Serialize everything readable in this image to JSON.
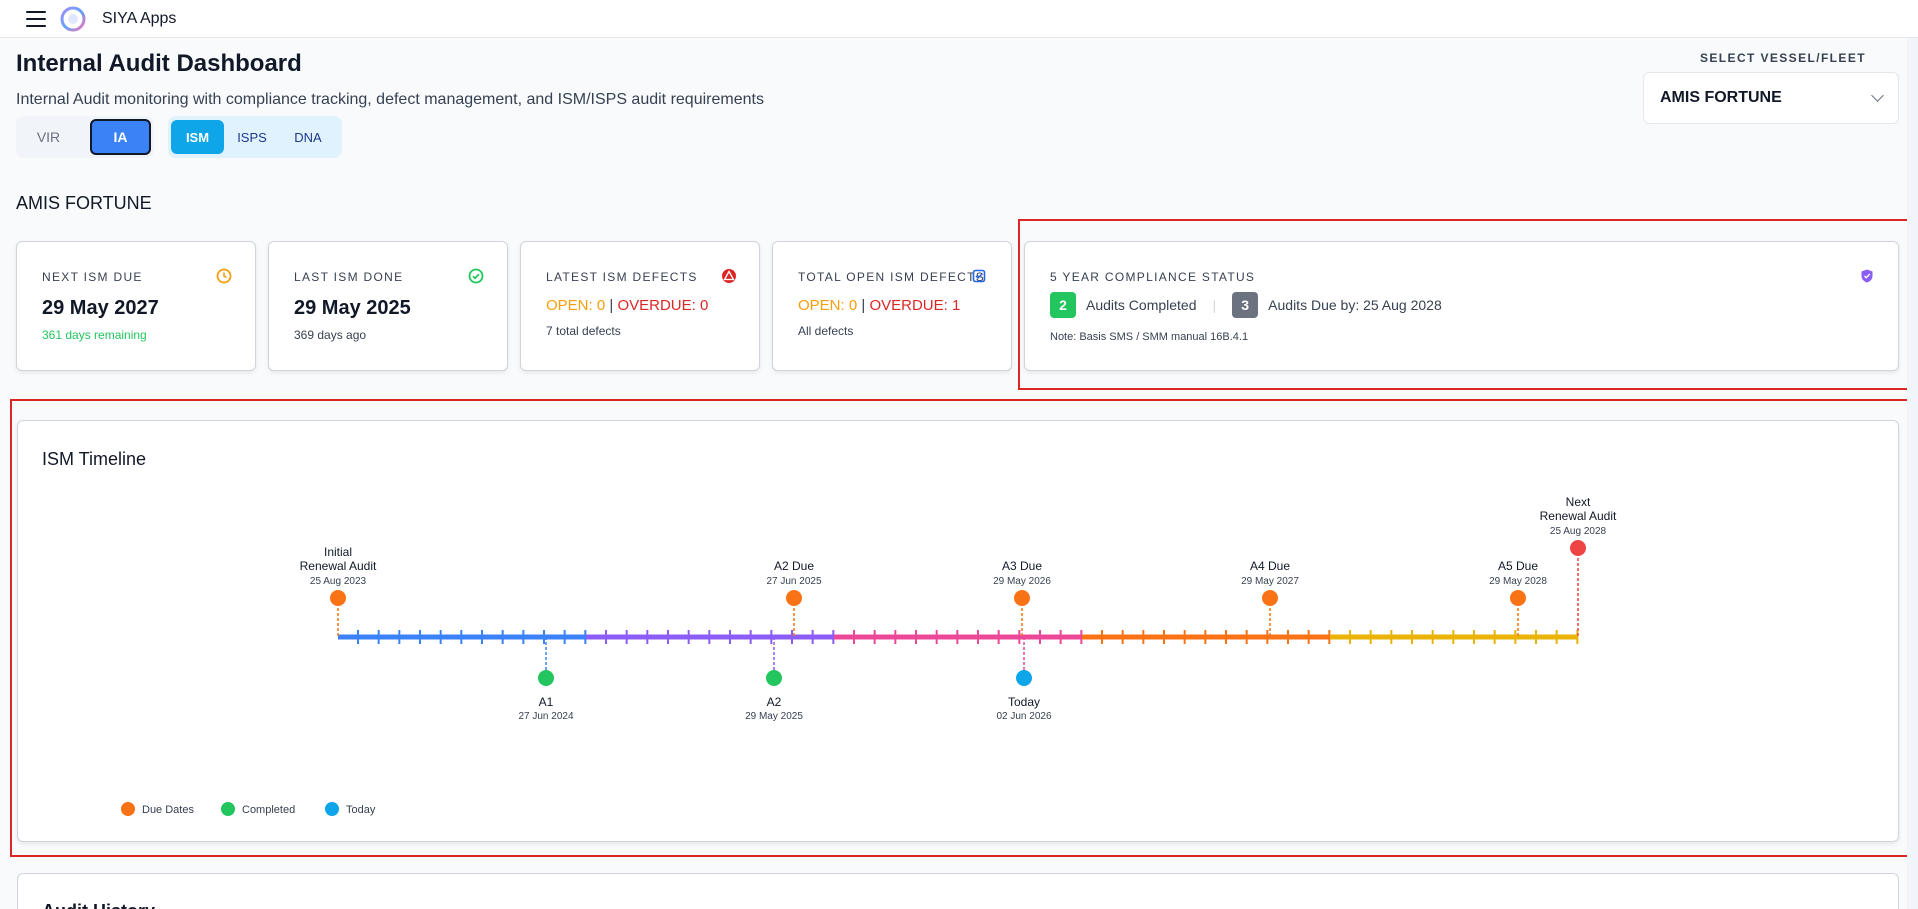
{
  "app": {
    "title": "SIYA Apps"
  },
  "page": {
    "title": "Internal Audit Dashboard",
    "subtitle": "Internal Audit monitoring with compliance tracking, defect management, and ISM/ISPS audit requirements"
  },
  "toggles": {
    "group1": [
      {
        "label": "VIR",
        "active": false
      },
      {
        "label": "IA",
        "active": true
      }
    ],
    "group2": [
      {
        "label": "ISM",
        "active": true
      },
      {
        "label": "ISPS",
        "active": false
      },
      {
        "label": "DNA",
        "active": false
      }
    ]
  },
  "vessel": {
    "select_label": "SELECT VESSEL/FLEET",
    "selected": "AMIS FORTUNE",
    "heading": "AMIS FORTUNE"
  },
  "cards": {
    "next_ism": {
      "label": "NEXT ISM DUE",
      "value": "29 May 2027",
      "note": "361 days remaining"
    },
    "last_ism": {
      "label": "LAST ISM DONE",
      "value": "29 May 2025",
      "note": "369 days ago"
    },
    "latest_defects": {
      "label": "LATEST ISM DEFECTS",
      "open": "OPEN: 0",
      "sep": "|",
      "overdue": "OVERDUE: 0",
      "note": "7 total defects"
    },
    "total_open": {
      "label": "TOTAL OPEN ISM DEFECTS",
      "open": "OPEN: 0",
      "sep": "|",
      "overdue": "OVERDUE: 1",
      "note": "All defects"
    },
    "compliance": {
      "label": "5 YEAR COMPLIANCE STATUS",
      "completed_count": "2",
      "completed_text": "Audits Completed",
      "divider": "|",
      "due_count": "3",
      "due_text": "Audits Due by: 25 Aug 2028",
      "note": "Note: Basis SMS / SMM manual 16B.4.1"
    }
  },
  "timeline": {
    "title": "ISM Timeline",
    "colors": {
      "segments": [
        "#3b82f6",
        "#8b5cf6",
        "#ec4899",
        "#f97316",
        "#eab308"
      ],
      "due": "#f97316",
      "completed": "#22c55e",
      "today": "#0ea5e9",
      "renewal_next": "#ef4444"
    },
    "above": [
      {
        "name": "initial-renewal",
        "title1": "Initial",
        "title2": "Renewal Audit",
        "date": "25 Aug 2023",
        "kind": "due"
      },
      {
        "name": "a2-due",
        "title1": "A2 Due",
        "title2": "",
        "date": "27 Jun 2025",
        "kind": "due"
      },
      {
        "name": "a3-due",
        "title1": "A3 Due",
        "title2": "",
        "date": "29 May 2026",
        "kind": "due"
      },
      {
        "name": "a4-due",
        "title1": "A4 Due",
        "title2": "",
        "date": "29 May 2027",
        "kind": "due"
      },
      {
        "name": "a5-due",
        "title1": "A5 Due",
        "title2": "",
        "date": "29 May 2028",
        "kind": "due"
      },
      {
        "name": "next-renewal",
        "title1": "Next",
        "title2": "Renewal Audit",
        "date": "25 Aug 2028",
        "kind": "renewal_next"
      }
    ],
    "below": [
      {
        "name": "a1",
        "title": "A1",
        "date": "27 Jun 2024",
        "kind": "completed"
      },
      {
        "name": "a2",
        "title": "A2",
        "date": "29 May 2025",
        "kind": "completed"
      },
      {
        "name": "today",
        "title": "Today",
        "date": "02 Jun 2026",
        "kind": "today"
      }
    ],
    "legend": [
      {
        "label": "Due Dates",
        "kind": "due"
      },
      {
        "label": "Completed",
        "kind": "completed"
      },
      {
        "label": "Today",
        "kind": "today"
      }
    ]
  },
  "next_section": {
    "title": "Audit History"
  }
}
